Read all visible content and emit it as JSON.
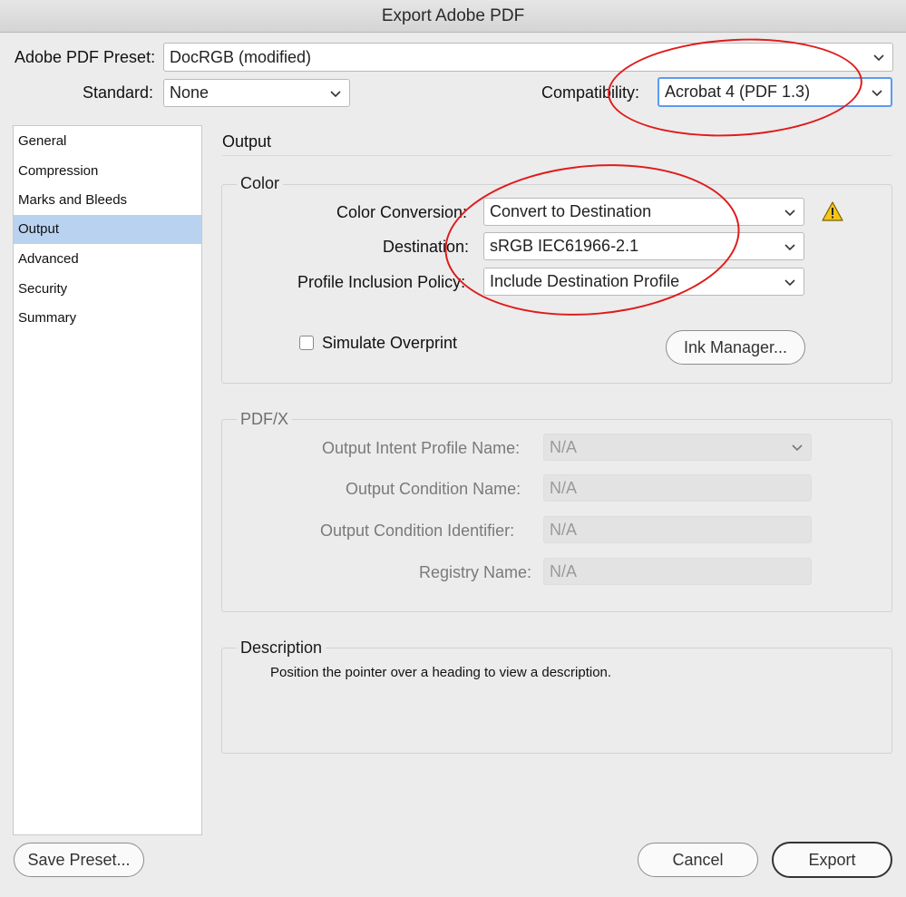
{
  "window": {
    "title": "Export Adobe PDF"
  },
  "preset": {
    "label": "Adobe PDF Preset:",
    "value": "DocRGB (modified)"
  },
  "standard": {
    "label": "Standard:",
    "value": "None"
  },
  "compatibility": {
    "label": "Compatibility:",
    "value": "Acrobat 4 (PDF 1.3)"
  },
  "sidebar": {
    "items": [
      {
        "label": "General"
      },
      {
        "label": "Compression"
      },
      {
        "label": "Marks and Bleeds"
      },
      {
        "label": "Output",
        "selected": true
      },
      {
        "label": "Advanced"
      },
      {
        "label": "Security"
      },
      {
        "label": "Summary"
      }
    ]
  },
  "output": {
    "heading": "Output",
    "color": {
      "legend": "Color",
      "conversion_label": "Color Conversion:",
      "conversion_value": "Convert to Destination",
      "destination_label": "Destination:",
      "destination_value": "sRGB IEC61966-2.1",
      "policy_label": "Profile Inclusion Policy:",
      "policy_value": "Include Destination Profile",
      "simulate_label": "Simulate Overprint",
      "simulate_checked": false,
      "ink_manager_label": "Ink Manager..."
    },
    "pdfx": {
      "legend": "PDF/X",
      "intent_label": "Output Intent Profile Name:",
      "intent_value": "N/A",
      "condition_label": "Output Condition Name:",
      "condition_value": "N/A",
      "identifier_label": "Output Condition Identifier:",
      "identifier_value": "N/A",
      "registry_label": "Registry Name:",
      "registry_value": "N/A"
    },
    "description": {
      "legend": "Description",
      "text": "Position the pointer over a heading to view a description."
    }
  },
  "buttons": {
    "save_preset": "Save Preset...",
    "cancel": "Cancel",
    "export": "Export"
  },
  "colors": {
    "selection": "#b9d2f0",
    "focus_ring": "#5a9cf0",
    "annotation": "#e01b1b",
    "warning": "#f5c518"
  },
  "icons": [
    "chevron-down-icon",
    "warning-icon",
    "checkbox-icon"
  ]
}
